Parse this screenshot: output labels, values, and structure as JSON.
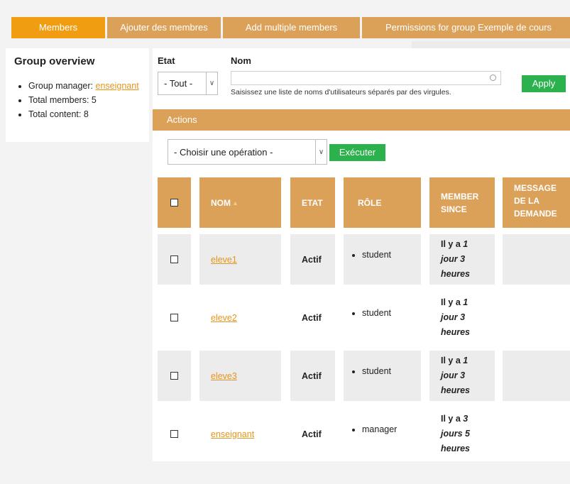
{
  "tabs": [
    {
      "label": "Members",
      "active": true
    },
    {
      "label": "Ajouter des membres"
    },
    {
      "label": "Add multiple members"
    },
    {
      "label": "Permissions for group Exemple de cours"
    }
  ],
  "sidebar": {
    "title": "Group overview",
    "manager_label": "Group manager: ",
    "manager_link": "enseignant",
    "total_members": "Total members: 5",
    "total_content": "Total content: 8"
  },
  "filters": {
    "etat_label": "Etat",
    "etat_value": "- Tout -",
    "nom_label": "Nom",
    "nom_value": "",
    "nom_hint": "Saisissez une liste de noms d'utilisateurs séparés par des virgules.",
    "apply_label": "Apply"
  },
  "actions": {
    "bar_label": "Actions",
    "operation_value": "- Choisir une opération -",
    "execute_label": "Exécuter"
  },
  "table": {
    "headers": {
      "nom": "NOM",
      "etat": "ETAT",
      "role": "RÔLE",
      "since_line1": "MEMBER",
      "since_line2": "SINCE",
      "message_line1": "MESSAGE",
      "message_line2": "DE LA",
      "message_line3": "DEMANDE"
    },
    "rows": [
      {
        "name": "eleve1",
        "etat": "Actif",
        "role": "student",
        "since_a": "Il y a ",
        "since_b": "1",
        "since_c": "jour 3",
        "since_d": "heures"
      },
      {
        "name": "eleve2",
        "etat": "Actif",
        "role": "student",
        "since_a": "Il y a ",
        "since_b": "1",
        "since_c": "jour 3",
        "since_d": "heures"
      },
      {
        "name": "eleve3",
        "etat": "Actif",
        "role": "student",
        "since_a": "Il y a ",
        "since_b": "1",
        "since_c": "jour 3",
        "since_d": "heures"
      },
      {
        "name": "enseignant",
        "etat": "Actif",
        "role": "manager",
        "since_a": "Il y a ",
        "since_b": "3",
        "since_c": "jours 5",
        "since_d": "heures"
      }
    ]
  },
  "colors": {
    "tab": "#dca159",
    "tab_active": "#f19d12",
    "button_green": "#2bb24c",
    "link": "#e6951b"
  }
}
